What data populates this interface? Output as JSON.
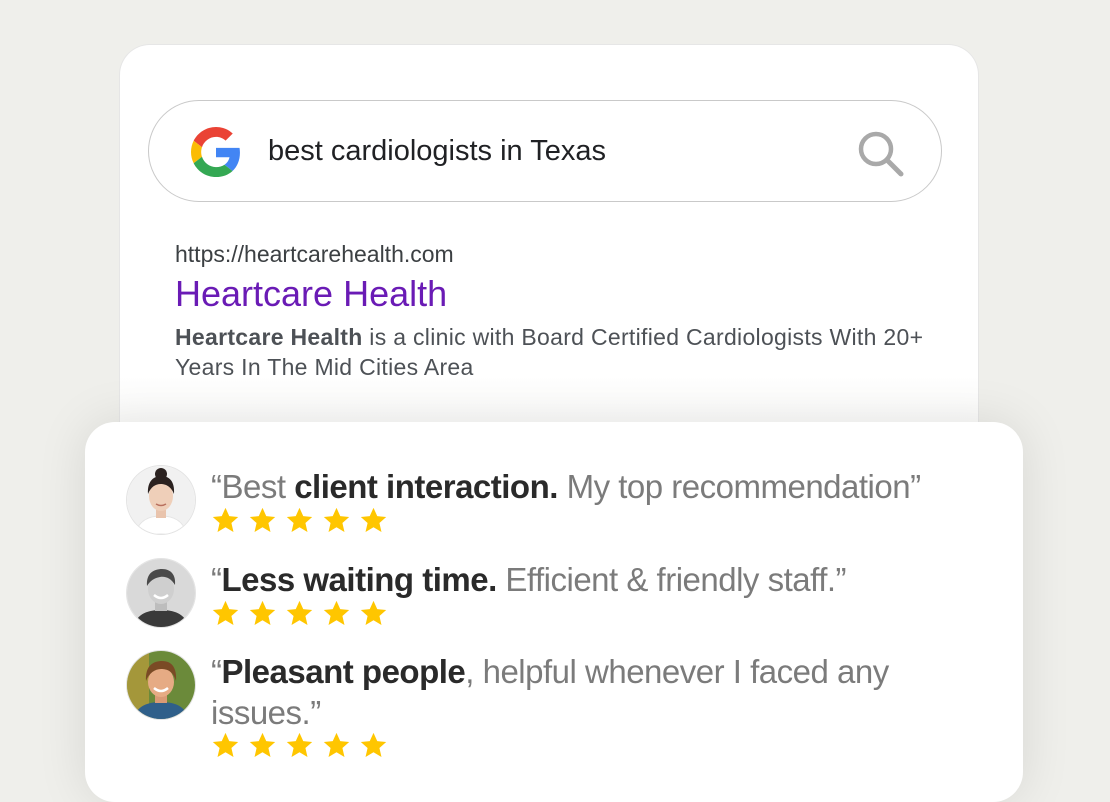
{
  "search": {
    "query": "best cardiologists in Texas"
  },
  "result": {
    "url": "https://heartcarehealth.com",
    "title": "Heartcare Health",
    "snippet_bold": "Heartcare Health",
    "snippet_rest": " is a clinic with Board Certified Cardiologists With 20+ Years In The Mid Cities Area"
  },
  "reviews": [
    {
      "open": "“Best ",
      "bold": "client interaction.",
      "rest": " My top recommendation”",
      "rating": 5
    },
    {
      "open": "“",
      "bold": "Less waiting time.",
      "rest": " Efficient & friendly staff.”",
      "rating": 5
    },
    {
      "open": "“",
      "bold": "Pleasant people",
      "rest": ", helpful whenever I faced any issues.”",
      "rating": 5
    }
  ],
  "colors": {
    "title_link": "#6a1bb5",
    "star": "#ffc600",
    "background": "#efefeb"
  },
  "icons": [
    "google-logo-icon",
    "search-icon",
    "star-icon"
  ]
}
